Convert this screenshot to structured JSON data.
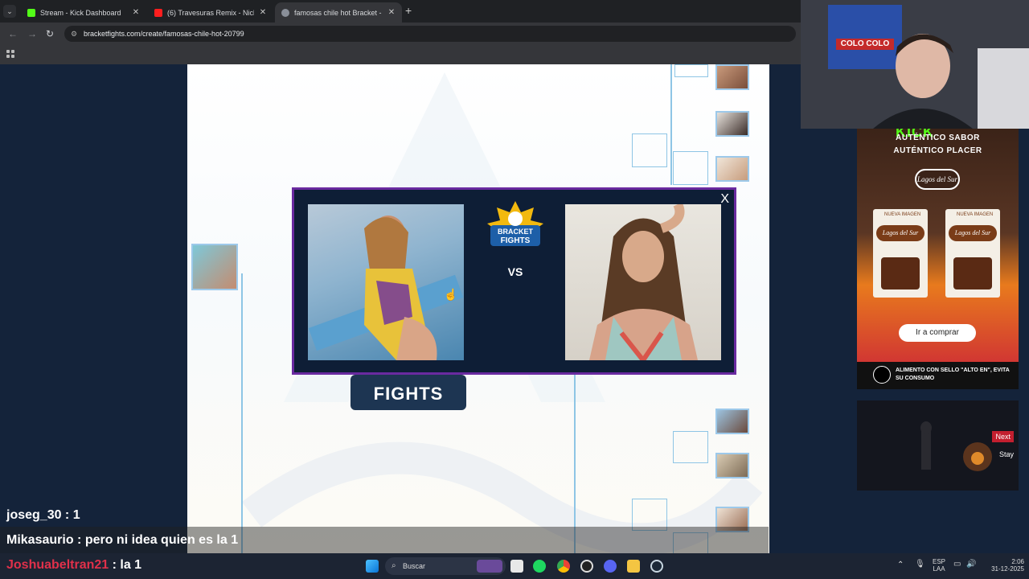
{
  "browser": {
    "tabs": [
      {
        "label": "Stream - Kick Dashboard",
        "icon": "kick-icon",
        "active": false
      },
      {
        "label": "(6) Travesuras Remix - Nicky Jam",
        "icon": "youtube-icon",
        "active": false
      },
      {
        "label": "famosas chile hot Bracket - Bra",
        "icon": "bracketfights-icon",
        "active": true
      }
    ],
    "url": "bracketfights.com/create/famosas-chile-hot-20799"
  },
  "modal": {
    "close_label": "X",
    "logo_text": "BRACKET\nFIGHTS",
    "vs_label": "VS"
  },
  "bracket_logo_text": "FIGHTS",
  "webcam": {
    "banner_text": "COLO COLO"
  },
  "ad": {
    "kick_label": "KICK",
    "line1": "AUTÉNTICO SABOR",
    "line2": "AUTÉNTICO PLACER",
    "brand": "Lagos del Sur",
    "pack_tag": "NUEVA IMAGEN",
    "cta": "Ir a comprar",
    "warning": "ALIMENTO CON SELLO \"ALTO EN\", EVITA SU CONSUMO"
  },
  "game_panel": {
    "next_label": "Next",
    "stay_label": "Stay"
  },
  "chat": [
    {
      "user": "joseg_30",
      "message": "1",
      "user_color": "#ffffff"
    },
    {
      "user": "Mikasaurio",
      "message": "pero ni idea quien es la 1",
      "user_color": "#ffffff"
    },
    {
      "user": "Joshuabeltran21",
      "message": "la 1",
      "user_color": "#e0304a"
    }
  ],
  "taskbar": {
    "search_placeholder": "Buscar",
    "lang_top": "ESP",
    "lang_bottom": "LAA",
    "time": "2:06",
    "date": "31-12-2025"
  },
  "colors": {
    "modal_border": "#6a2aa0",
    "kick_green": "#53fc18",
    "bracket_line": "#8ec5e5"
  }
}
